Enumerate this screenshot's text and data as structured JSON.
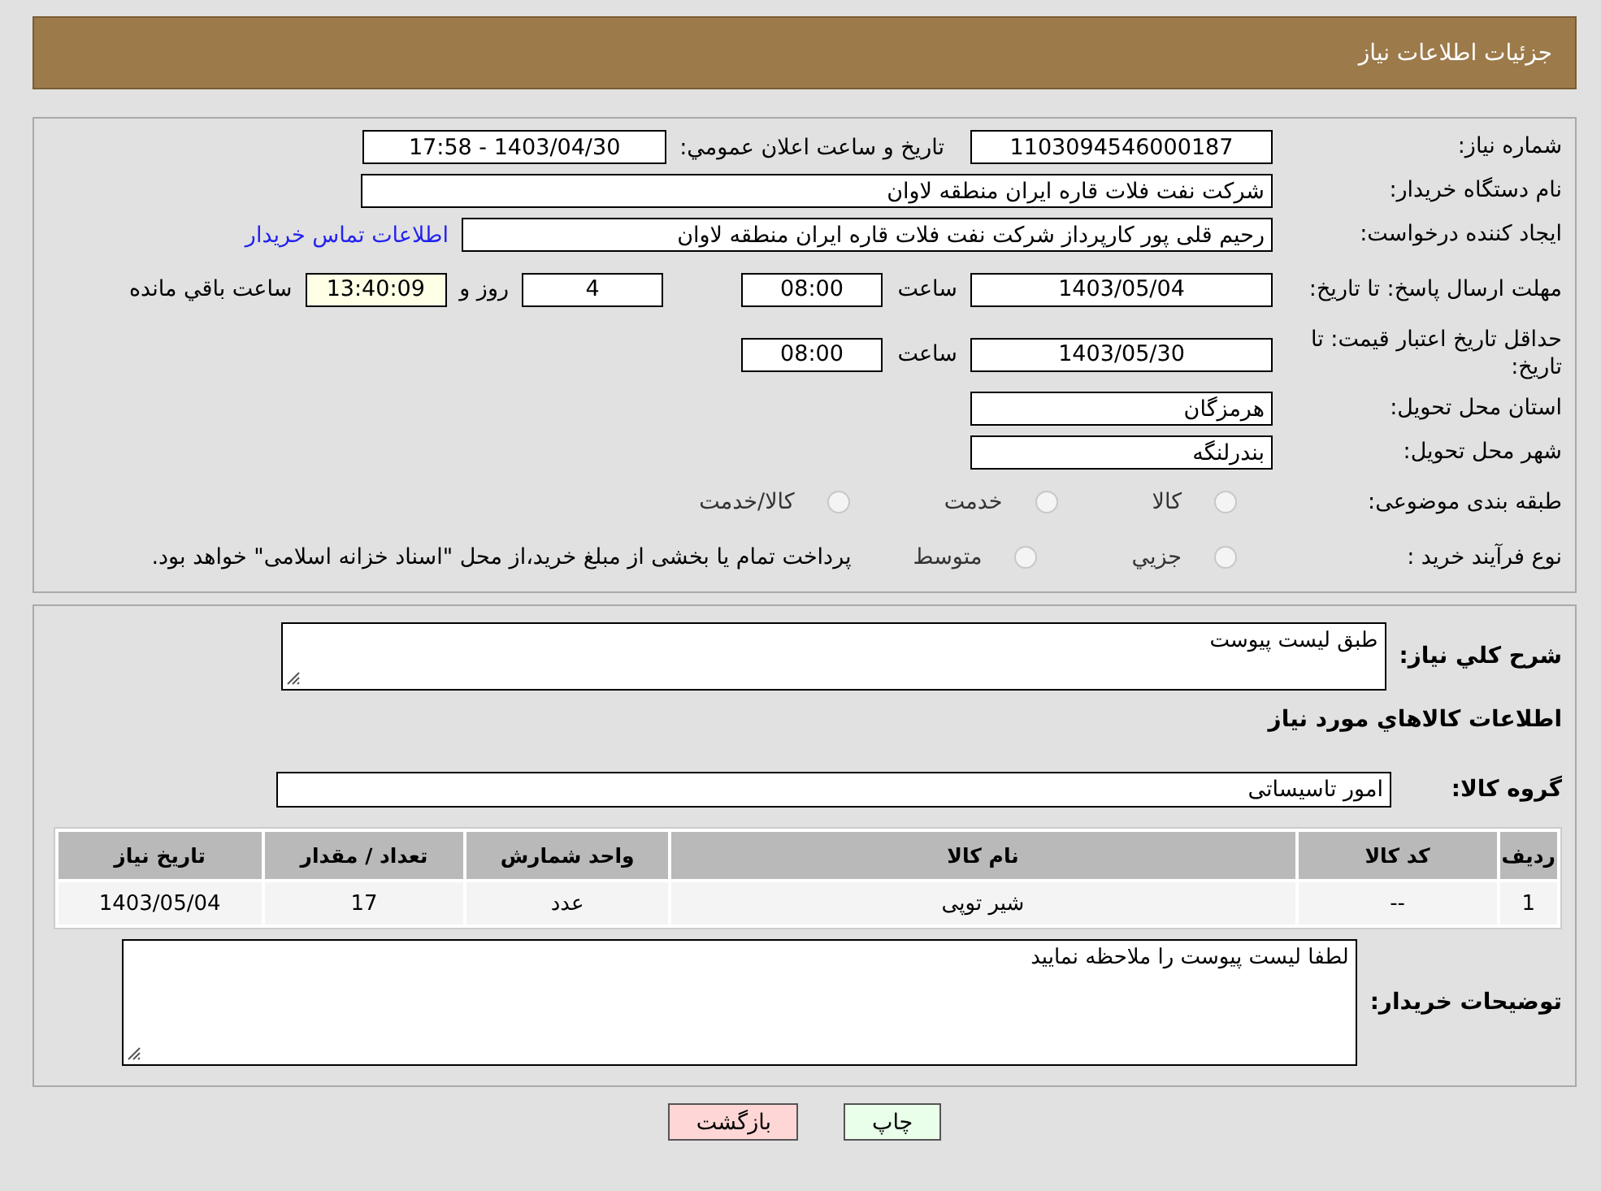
{
  "header": {
    "title": "جزئیات اطلاعات نیاز"
  },
  "need_number": {
    "label": "شماره نیاز:",
    "value": "1103094546000187"
  },
  "announce": {
    "label": "تاريخ و ساعت اعلان عمومي:",
    "value": "1403/04/30 - 17:58"
  },
  "buyer": {
    "label": "نام دستگاه خریدار:",
    "value": "شرکت نفت فلات قاره ایران منطقه لاوان"
  },
  "requester": {
    "label": "ایجاد کننده درخواست:",
    "value": "رحیم قلی پور کارپرداز شرکت نفت فلات قاره ایران منطقه لاوان",
    "link": "اطلاعات تماس خريدار"
  },
  "reply_deadline": {
    "label": "مهلت ارسال پاسخ: تا تاریخ:",
    "date": "1403/05/04",
    "time_label": "ساعت",
    "time": "08:00",
    "days": "4",
    "days_label": "روز و",
    "remaining": "13:40:09",
    "remaining_label": "ساعت باقي مانده"
  },
  "price_validity": {
    "label": "حداقل تاریخ اعتبار قیمت: تا تاریخ:",
    "date": "1403/05/30",
    "time_label": "ساعت",
    "time": "08:00"
  },
  "province": {
    "label": "استان محل تحویل:",
    "value": "هرمزگان"
  },
  "city": {
    "label": "شهر محل تحویل:",
    "value": "بندرلنگه"
  },
  "category": {
    "label": "طبقه بندی موضوعی:",
    "options": [
      {
        "label": "کالا",
        "selected": false
      },
      {
        "label": "خدمت",
        "selected": false
      },
      {
        "label": "کالا/خدمت",
        "selected": false
      }
    ]
  },
  "process": {
    "label": "نوع فرآیند خرید :",
    "options": [
      {
        "label": "جزيي",
        "selected": false
      },
      {
        "label": "متوسط",
        "selected": false
      }
    ],
    "note": "پرداخت تمام يا بخشی از مبلغ خريد،از محل \"اسناد خزانه اسلامی\" خواهد بود."
  },
  "description": {
    "label": "شرح کلي نياز:",
    "value": "طبق لیست پیوست"
  },
  "goods_title": "اطلاعات کالاهاي مورد نياز",
  "goods_group": {
    "label": "گروه کالا:",
    "value": "امور تاسیساتی"
  },
  "table": {
    "columns": [
      "ردیف",
      "کد کالا",
      "نام کالا",
      "واحد شمارش",
      "تعداد / مقدار",
      "تاريخ نياز"
    ],
    "rows": [
      [
        "1",
        "--",
        "شیر توپی",
        "عدد",
        "17",
        "1403/05/04"
      ]
    ]
  },
  "buyer_notes": {
    "label": "توضیحات خریدار:",
    "value": "لطفا لیست پیوست را ملاحظه نمایید"
  },
  "buttons": [
    {
      "label": "چاپ",
      "kind": "print"
    },
    {
      "label": "بازگشت",
      "kind": "back"
    }
  ]
}
